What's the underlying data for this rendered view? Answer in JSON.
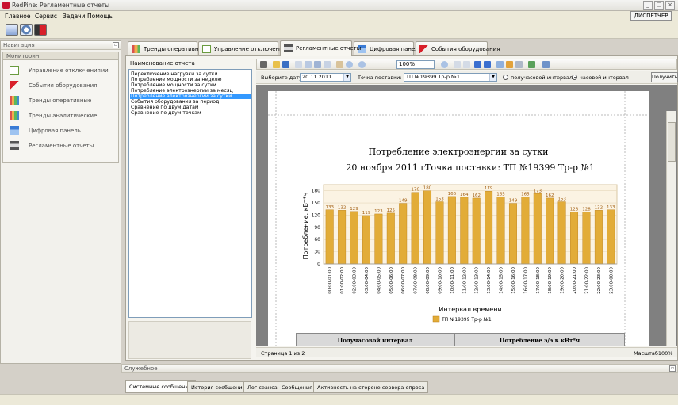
{
  "window": {
    "title": "RedPine: Регламентные отчеты"
  },
  "menu": [
    "Главное",
    "Сервис",
    "Задачи",
    "Помощь"
  ],
  "dispatcher_button": "ДИСПЕТЧЕР",
  "toolbar_icons": [
    "mail-icon",
    "refresh-icon",
    "exit-icon"
  ],
  "navigation": {
    "header": "Навигация",
    "group": "Мониторинг",
    "items": [
      {
        "label": "Управление отключениями",
        "icon": "checklist-icon"
      },
      {
        "label": "События оборудования",
        "icon": "flag-icon"
      },
      {
        "label": "Тренды оперативные",
        "icon": "bar-chart-icon"
      },
      {
        "label": "Тренды аналитические",
        "icon": "bar-chart-icon"
      },
      {
        "label": "Цифровая панель",
        "icon": "panel-icon"
      },
      {
        "label": "Регламентные отчеты",
        "icon": "printer-icon"
      }
    ]
  },
  "tabs": [
    {
      "label": "Тренды оперативные",
      "active": false
    },
    {
      "label": "Управление отключениями",
      "active": false
    },
    {
      "label": "Регламентные отчеты",
      "active": true
    },
    {
      "label": "Цифровая панель",
      "active": false
    },
    {
      "label": "События оборудования",
      "active": false
    }
  ],
  "report_list": {
    "title": "Наименование отчета",
    "items": [
      "Переключение нагрузки за сутки",
      "Потребление мощности за неделю",
      "Потребление мощности за сутки",
      "Потребление электроэнергии за месяц",
      "Потребление электроэнергии за сутки",
      "События оборудования за период",
      "Сравнение по двум датам",
      "Сравнение по двум точкам"
    ],
    "selected_index": 4
  },
  "viewer": {
    "zoom": "100%",
    "date_label": "Выберите дату:",
    "date_value": "20.11.2011",
    "point_label": "Точка поставки:",
    "point_value": "ТП №19399 Тр-р №1",
    "radio_half_hour": "получасовой интервал",
    "radio_hour": "часовой интервал",
    "radio_selected": "hour",
    "get_button": "Получить",
    "page_status": "Страница 1 из 2",
    "scale_status": "Масштаб100%"
  },
  "report": {
    "title": "Потребление электроэнергии за сутки",
    "date_line": "20 ноября 2011 г.",
    "point_line": "Точка поставки: ТП №19399 Тр-р №1",
    "table_col1": "Получасовой интервал",
    "table_col2": "Потребление э/э в кВт*ч"
  },
  "chart_data": {
    "type": "bar",
    "categories": [
      "00:00-01:00",
      "01:00-02:00",
      "02:00-03:00",
      "03:00-04:00",
      "04:00-05:00",
      "05:00-06:00",
      "06:00-07:00",
      "07:00-08:00",
      "08:00-09:00",
      "09:00-10:00",
      "10:00-11:00",
      "11:00-12:00",
      "12:00-13:00",
      "13:00-14:00",
      "14:00-15:00",
      "15:00-16:00",
      "16:00-17:00",
      "17:00-18:00",
      "18:00-19:00",
      "19:00-20:00",
      "20:00-21:00",
      "21:00-22:00",
      "22:00-23:00",
      "23:00-00:00"
    ],
    "series": [
      {
        "name": "ТП №19399 Тр-р №1",
        "values": [
          133,
          132,
          129,
          119,
          123,
          125,
          149,
          176,
          180,
          153,
          166,
          164,
          162,
          179,
          165,
          149,
          165,
          173,
          162,
          153,
          128,
          128,
          132,
          133
        ]
      }
    ],
    "xlabel": "Интервал времени",
    "ylabel": "Потребление, кВт*ч",
    "ylim": [
      0,
      195
    ],
    "yticks": [
      0,
      30,
      60,
      90,
      120,
      150,
      180
    ],
    "grid": true,
    "legend": "bottom",
    "bar_color": "#e2ac38",
    "label_color": "#a05d10"
  },
  "service_panel": {
    "header": "Служебное",
    "tabs": [
      "Системные сообщения",
      "История сообщений",
      "Лог сеанса",
      "Сообщения",
      "Активность на стороне сервера опроса"
    ],
    "active_index": 0
  }
}
